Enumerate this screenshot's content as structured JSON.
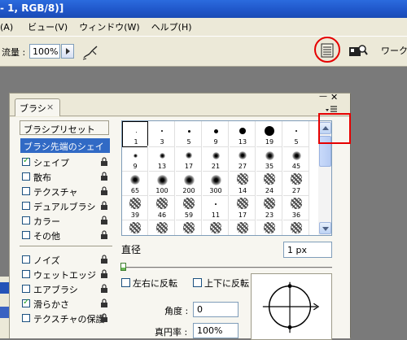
{
  "window": {
    "title": "- 1, RGB/8)]"
  },
  "menu": [
    "(A)",
    "ビュー(V)",
    "ウィンドウ(W)",
    "ヘルプ(H)"
  ],
  "options": {
    "flow_label": "流量 :",
    "flow_value": "100%",
    "workspace_label": "ワークス"
  },
  "palette": {
    "tab_label": "ブラシ",
    "tab_close": "×",
    "min_glyph": "—",
    "close_glyph": "✕",
    "presets_button": "ブラシプリセット",
    "tip_shape_label": "ブラシ先端のシェイプ",
    "options": [
      {
        "label": "シェイプ",
        "checked": true
      },
      {
        "label": "散布",
        "checked": false
      },
      {
        "label": "テクスチャ",
        "checked": false
      },
      {
        "label": "デュアルブラシ",
        "checked": false
      },
      {
        "label": "カラー",
        "checked": false
      },
      {
        "label": "その他",
        "checked": false
      }
    ],
    "options2": [
      {
        "label": "ノイズ",
        "checked": false
      },
      {
        "label": "ウェットエッジ",
        "checked": false
      },
      {
        "label": "エアブラシ",
        "checked": false
      },
      {
        "label": "滑らかさ",
        "checked": true
      },
      {
        "label": "テクスチャの保護",
        "checked": false
      }
    ],
    "brushes": [
      [
        "1",
        "3",
        "5",
        "9",
        "13",
        "19",
        "5"
      ],
      [
        "9",
        "13",
        "17",
        "21",
        "27",
        "35",
        "45"
      ],
      [
        "65",
        "100",
        "200",
        "300",
        "14",
        "24",
        "27"
      ],
      [
        "39",
        "46",
        "59",
        "11",
        "17",
        "23",
        "36"
      ],
      [
        "",
        "",
        "",
        "",
        "",
        "",
        ""
      ]
    ],
    "diameter_label": "直径",
    "diameter_value": "1 px",
    "flip_x_label": "左右に反転",
    "flip_y_label": "上下に反転",
    "angle_label": "角度 :",
    "angle_value": "0",
    "roundness_label": "真円率 :",
    "roundness_value": "100%"
  }
}
